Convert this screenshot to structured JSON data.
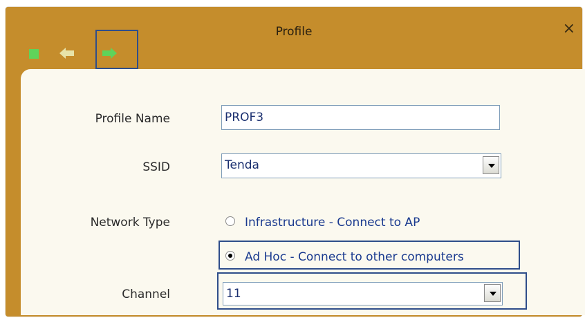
{
  "window": {
    "title": "Profile",
    "close_symbol": "×"
  },
  "toolbar": {
    "icons": [
      "green-square-icon",
      "back-arrow-icon",
      "forward-arrow-icon"
    ]
  },
  "form": {
    "profile_name_label": "Profile Name",
    "profile_name_value": "PROF3",
    "ssid_label": "SSID",
    "ssid_value": "Tenda",
    "network_type_label": "Network Type",
    "network_options": [
      {
        "label": "Infrastructure - Connect to AP",
        "checked": false
      },
      {
        "label": "Ad Hoc - Connect to other computers",
        "checked": true
      }
    ],
    "channel_label": "Channel",
    "channel_value": "11"
  },
  "colors": {
    "frame": "#c58d2c",
    "panel": "#fbf9ef",
    "highlight": "#2e4d8a",
    "icon_green": "#5fd35a"
  }
}
